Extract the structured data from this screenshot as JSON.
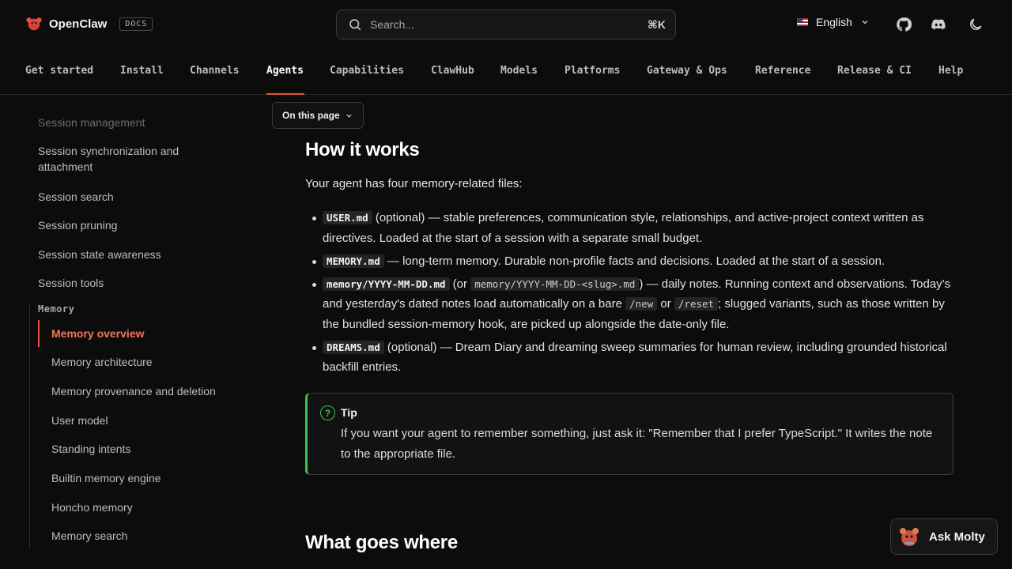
{
  "header": {
    "brand": "OpenClaw",
    "badge": "DOCS",
    "search_placeholder": "Search...",
    "search_shortcut": "⌘K",
    "language": "English"
  },
  "nav": {
    "tabs": [
      "Get started",
      "Install",
      "Channels",
      "Agents",
      "Capabilities",
      "ClawHub",
      "Models",
      "Platforms",
      "Gateway & Ops",
      "Reference",
      "Release & CI",
      "Help"
    ],
    "active": "Agents"
  },
  "sidebar": {
    "items_top": [
      "Session management",
      "Session synchronization and attachment",
      "Session search",
      "Session pruning",
      "Session state awareness",
      "Session tools"
    ],
    "section": "Memory",
    "memory_items": [
      "Memory overview",
      "Memory architecture",
      "Memory provenance and deletion",
      "User model",
      "Standing intents",
      "Builtin memory engine",
      "Honcho memory",
      "Memory search"
    ],
    "active": "Memory overview"
  },
  "main": {
    "on_this_page": "On this page",
    "heading1": "How it works",
    "intro": "Your agent has four memory-related files:",
    "bullets": [
      {
        "code": "USER.md",
        "text": " (optional) — stable preferences, communication style, relationships, and active-project context written as directives. Loaded at the start of a session with a separate small budget."
      },
      {
        "code": "MEMORY.md",
        "text": " — long-term memory. Durable non-profile facts and decisions. Loaded at the start of a session."
      },
      {
        "code": "memory/YYYY-MM-DD.md",
        "pre": " (or ",
        "code2": "memory/YYYY-MM-DD-<slug>.md",
        "mid": ") — daily notes. Running context and observations. Today's and yesterday's dated notes load automatically on a bare ",
        "code3": "/new",
        "or": " or ",
        "code4": "/reset",
        "post": "; slugged variants, such as those written by the bundled session-memory hook, are picked up alongside the date-only file."
      },
      {
        "code": "DREAMS.md",
        "text": " (optional) — Dream Diary and dreaming sweep summaries for human review, including grounded historical backfill entries."
      }
    ],
    "tip": {
      "title": "Tip",
      "body": "If you want your agent to remember something, just ask it: \"Remember that I prefer TypeScript.\" It writes the note to the appropriate file."
    },
    "heading2": "What goes where"
  },
  "ask_button": "Ask Molty",
  "colors": {
    "accent": "#e5533d",
    "tip_green": "#3fbf55",
    "background": "#0c0c0c"
  }
}
